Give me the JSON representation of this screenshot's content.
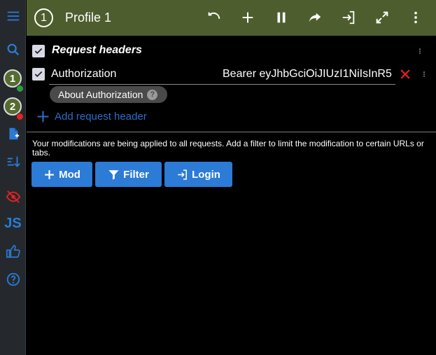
{
  "header": {
    "profile_number": "1",
    "title": "Profile 1"
  },
  "sidebar": {
    "profiles": [
      {
        "number": "1",
        "status": "active"
      },
      {
        "number": "2",
        "status": "paused"
      }
    ],
    "js_label": "JS"
  },
  "section": {
    "title": "Request headers"
  },
  "request_header": {
    "name": "Authorization",
    "value": "Bearer eyJhbGciOiJIUzI1NiIsInR5",
    "chip_label": "About Authorization",
    "chip_help": "?"
  },
  "add_header_label": "Add request header",
  "notice": "Your modifications are being applied to all requests. Add a filter to limit the modification to certain URLs or tabs.",
  "buttons": {
    "mod": "Mod",
    "filter": "Filter",
    "login": "Login"
  },
  "colors": {
    "header_bg": "#4e5d2e",
    "sidebar_bg": "#25292d",
    "accent_blue": "#2c7bd6",
    "link_blue": "#2a6ec9",
    "delete_red": "#e52222",
    "status_green": "#2e9d3a"
  }
}
